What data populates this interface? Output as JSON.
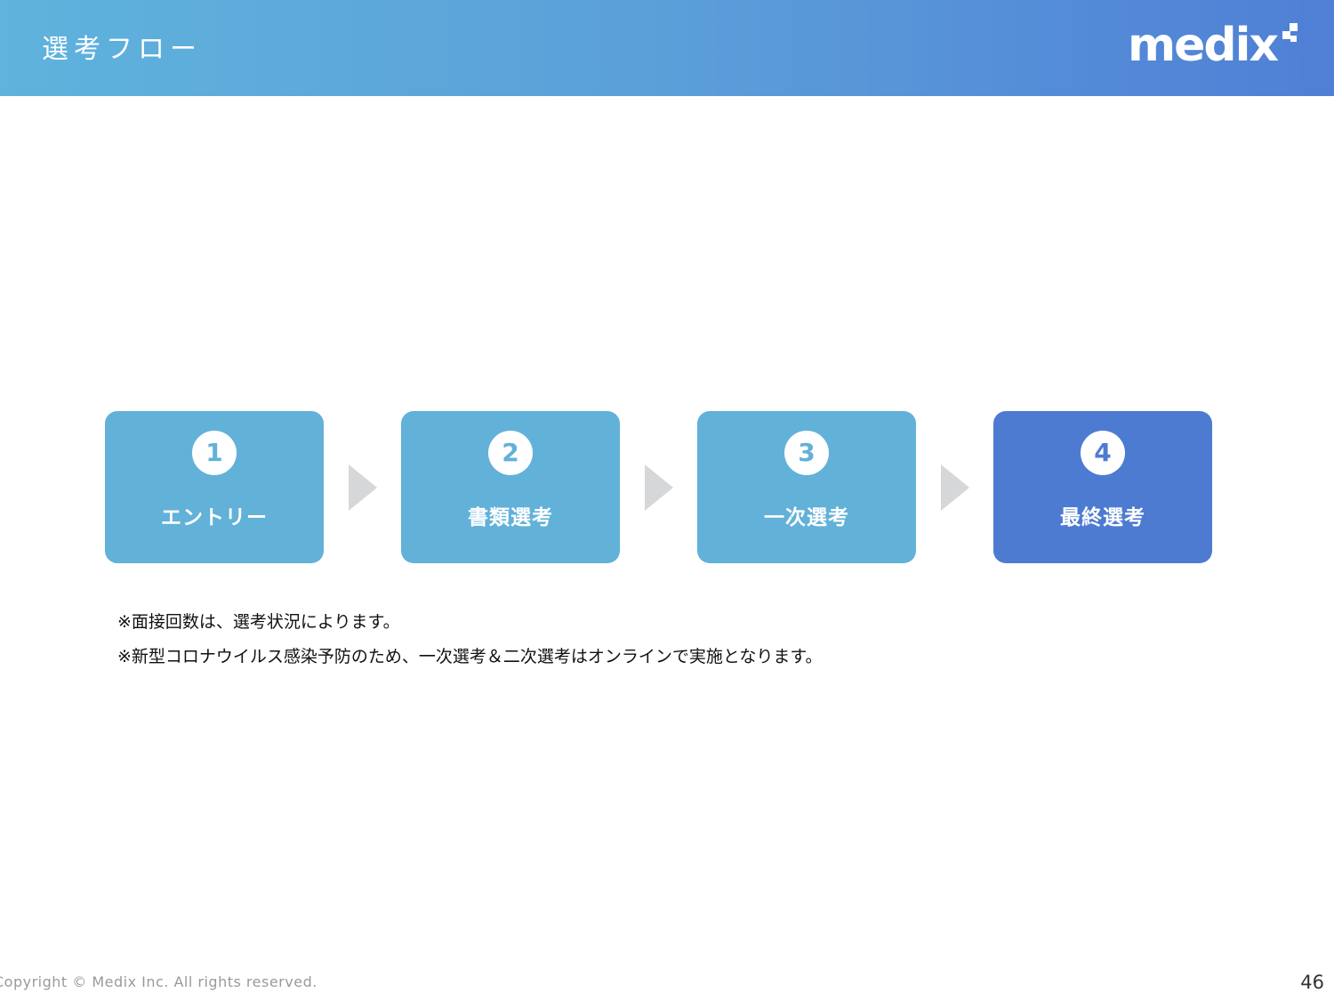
{
  "header": {
    "title": "選考フロー",
    "logo_text": "medix",
    "gradient_start": "#5fb3dc",
    "gradient_end": "#4f7fd6"
  },
  "flow": {
    "steps": [
      {
        "number": "1",
        "label": "エントリー",
        "color": "#62b1d8"
      },
      {
        "number": "2",
        "label": "書類選考",
        "color": "#62b1d8"
      },
      {
        "number": "3",
        "label": "一次選考",
        "color": "#62b1d8"
      },
      {
        "number": "4",
        "label": "最終選考",
        "color": "#4d7bd1"
      }
    ],
    "arrow_color": "#d5d7d9"
  },
  "notes": [
    "※面接回数は、選考状況によります。",
    "※新型コロナウイルス感染予防のため、一次選考＆二次選考はオンラインで実施となります。"
  ],
  "footer": {
    "copyright": "Copyright © Medix Inc. All rights reserved.",
    "page_number": "46"
  }
}
